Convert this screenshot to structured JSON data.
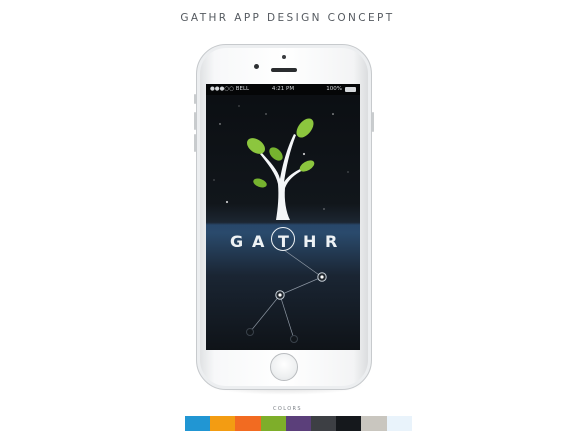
{
  "page": {
    "title": "GATHR APP DESIGN CONCEPT"
  },
  "statusbar": {
    "carrier": "●●●○○ BELL",
    "time": "4:21 PM",
    "battery": "100%"
  },
  "app": {
    "letters": [
      "G",
      "A",
      "T",
      "H",
      "R"
    ]
  },
  "palette": {
    "label": "COLORS",
    "swatches": [
      {
        "color": "#2196d3"
      },
      {
        "color": "#f39c12"
      },
      {
        "color": "#f26b21"
      },
      {
        "color": "#7eae2a"
      },
      {
        "color": "#5b3f7a"
      },
      {
        "color": "#3d3f44"
      },
      {
        "color": "#15181c"
      },
      {
        "color": "#c9c6bf"
      },
      {
        "color": "#e9f3fb"
      }
    ]
  }
}
